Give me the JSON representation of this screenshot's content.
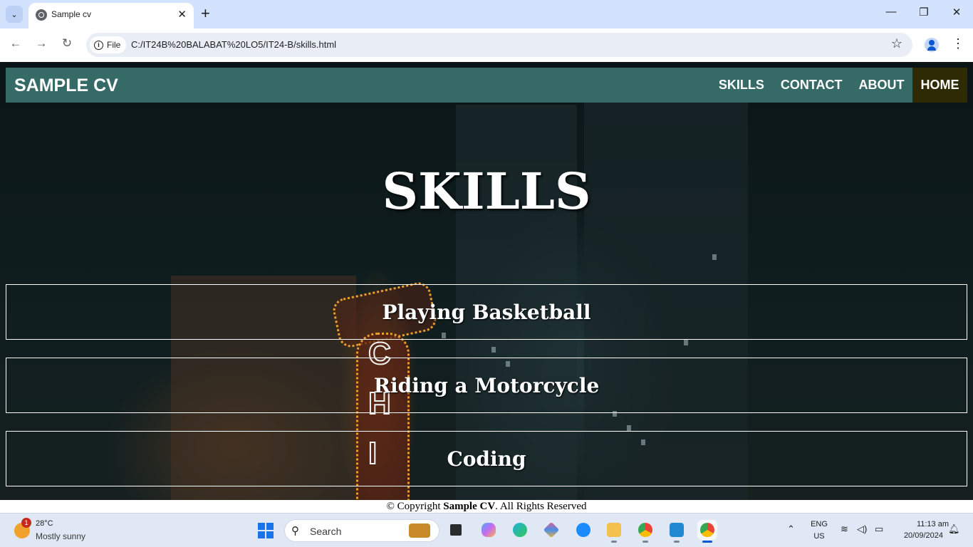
{
  "browser": {
    "tab_title": "Sample cv",
    "url_chip": "File",
    "url": "C:/IT24B%20BALABAT%20LO5/IT24-B/skills.html"
  },
  "page": {
    "brand": "SAMPLE CV",
    "nav": [
      {
        "label": "SKILLS",
        "active": false
      },
      {
        "label": "CONTACT",
        "active": false
      },
      {
        "label": "ABOUT",
        "active": false
      },
      {
        "label": "HOME",
        "active": true
      }
    ],
    "heading": "SKILLS",
    "skills": [
      "Playing Basketball",
      "Riding a Motorcycle",
      "Coding"
    ],
    "footer": {
      "prefix": "© Copyright ",
      "brand": "Sample CV",
      "suffix": ". All Rights Reserved"
    }
  },
  "taskbar": {
    "weather": {
      "badge": "1",
      "temp": "28°C",
      "desc": "Mostly sunny"
    },
    "search_placeholder": "Search",
    "lang": "ENG",
    "region": "US",
    "time": "11:13 am",
    "date": "20/09/2024"
  },
  "colors": {
    "navbar": "#356a66",
    "nav_active": "#2e2a04",
    "accent": "#0b57d0"
  }
}
